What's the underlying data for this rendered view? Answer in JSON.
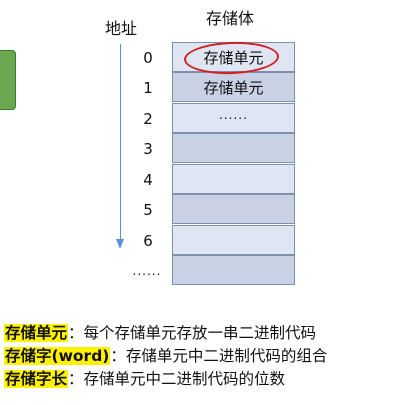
{
  "diagram": {
    "address_header": "地址",
    "storage_header": "存储体",
    "addresses": [
      "0",
      "1",
      "2",
      "3",
      "4",
      "5",
      "6",
      "......"
    ],
    "cells": [
      "存储单元",
      "存储单元",
      "......",
      "",
      "",
      "",
      "",
      ""
    ],
    "highlighted_cell_index": 0
  },
  "definitions": [
    {
      "term": "存储单元",
      "desc": "：每个存储单元存放一串二进制代码"
    },
    {
      "term": "存储字(word)",
      "desc": "：存储单元中二进制代码的组合"
    },
    {
      "term": "存储字长",
      "desc": "：存储单元中二进制代码的位数"
    }
  ],
  "colors": {
    "highlight": "#fff200",
    "cell_light": "#dfe5f2",
    "cell_mid": "#c9d1e5",
    "circle": "#d21f1f",
    "arrow": "#5b8fd6",
    "side_tab": "#6aa84f"
  }
}
